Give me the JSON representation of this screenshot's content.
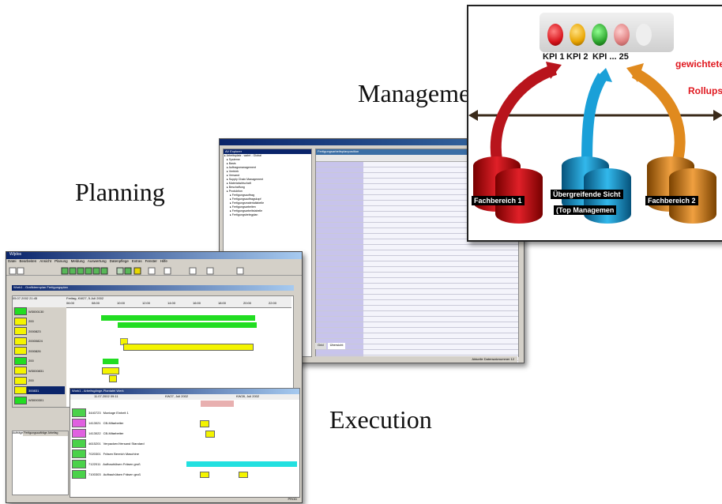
{
  "labels": {
    "management": "Management",
    "planning": "Planning",
    "execution": "Execution"
  },
  "management": {
    "kpi_labels": [
      "KPI 1",
      "KPI 2",
      "KPI ... 25"
    ],
    "kpi_colors": [
      "#d8141c",
      "#e8a400",
      "#2ea52e",
      "#e08080"
    ],
    "weighted_label_1": "gewichtete",
    "weighted_label_2": "Rollups",
    "departments": [
      "Fachbereich 1",
      "Übergreifende Sicht",
      "(Top Managemen",
      "Fachbereich 2"
    ],
    "colors": {
      "red": "#c8141c",
      "blue": "#1aa0d8",
      "orange": "#e08a1e"
    }
  },
  "planning": {
    "window_title": "Fertigungsarbeitsplanposition",
    "explorer_title": "AV Explorer",
    "tree": [
      "Arbeitsplatz - wahrt - Global",
      "Systeme",
      "Basis",
      "Auftragsmanagement",
      "Vertrieb",
      "Versand",
      "Supply Chain Management",
      "Materialwirtschaft",
      "Beschaffung",
      "Produktion",
      "Fertigungsauftrag",
      "Fertigungsauftragskopf",
      "Fertigungsmaterialtabelle",
      "Fertigungsarbeiten",
      "Fertigungsarbeitstabelle",
      "Fertigungsbelegplan"
    ],
    "tabs": [
      "Grid",
      "Übersicht"
    ],
    "status": "Aktuelle Datensatznummer 12"
  },
  "execution": {
    "window_title": "Wijdos",
    "menu": [
      "Datei",
      "Bearbeiten",
      "Ansicht",
      "Planung",
      "Meldung",
      "Auswertung",
      "Datenpflege",
      "Extras",
      "Fenster",
      "Hilfe"
    ],
    "panel_title": "Work1 - Grafiktermplan Fertigungsplan",
    "date_header": "05.07.2002 21:45",
    "day_header": "Freitag, KW27, 5.Juli 2002",
    "times": [
      "06:00",
      "08:00",
      "10:00",
      "12:00",
      "14:00",
      "16:00",
      "18:00",
      "20:00",
      "22:00"
    ],
    "orders": [
      "W3000130",
      "200",
      "2000823",
      "20000824",
      "2000826",
      "200",
      "W3000831",
      "200",
      "300831",
      "W3000301"
    ],
    "sub_title": "Work1 - Arbeitsgänge-Plantafel Werk",
    "sub_date": "11.07.2002 09:11",
    "week_headers": [
      "KW27, Juli 2002",
      "KW28, Juli 2002"
    ],
    "resources": [
      {
        "code": "3440723",
        "label": "Montage Einheit 1"
      },
      {
        "code": "1413021",
        "label": "CB-Mitarbeiter"
      },
      {
        "code": "1413022",
        "label": "CB-Mitarbeiter"
      },
      {
        "code": "4615201",
        "label": "Verpacken/Versand Standard"
      },
      {
        "code": "7020301",
        "label": "Fräsen Bereich Maschine"
      },
      {
        "code": "7122011",
        "label": "Aufbauhülsen Fräsen groß"
      },
      {
        "code": "7100303",
        "label": "Aufbauhülsen Fräsen groß"
      }
    ],
    "bottom_tabs": [
      "Aufträge",
      "Fertigungsaufträge",
      "Arbeitsg"
    ],
    "status_right": "PROD"
  }
}
